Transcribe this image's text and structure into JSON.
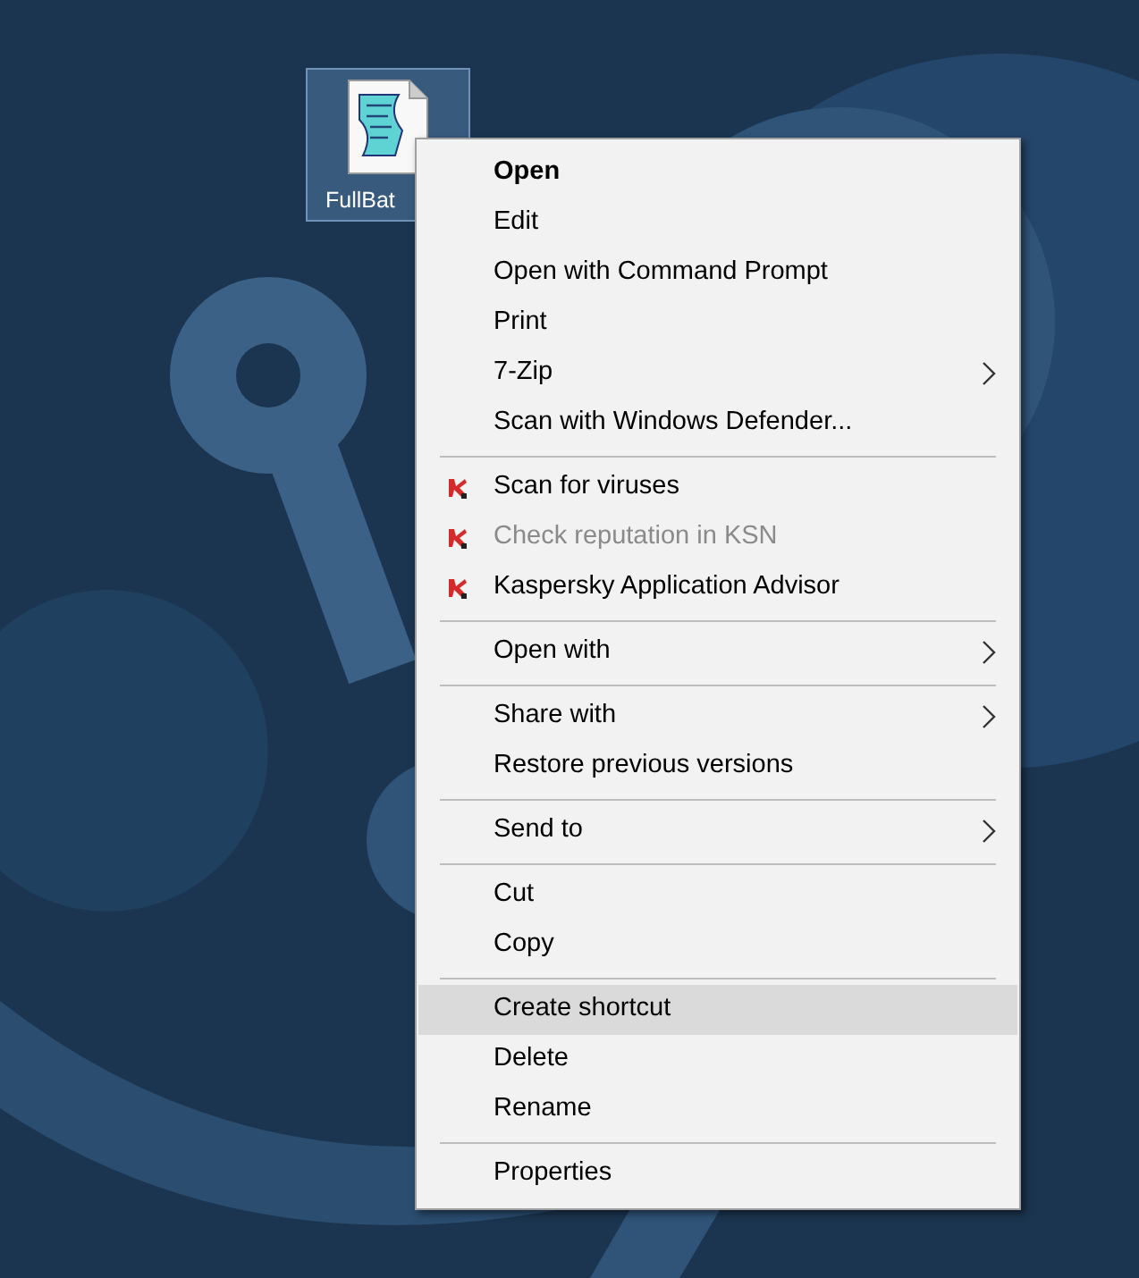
{
  "desktop": {
    "icons": [
      {
        "label": "FullBat",
        "selected": true
      }
    ]
  },
  "context_menu": {
    "sections": [
      {
        "items": [
          {
            "label": "Open",
            "kind": "plain",
            "default": true,
            "disabled": false,
            "selected": false
          },
          {
            "label": "Edit",
            "kind": "plain",
            "default": false,
            "disabled": false,
            "selected": false
          },
          {
            "label": "Open with Command Prompt",
            "kind": "plain",
            "default": false,
            "disabled": false,
            "selected": false
          },
          {
            "label": "Print",
            "kind": "plain",
            "default": false,
            "disabled": false,
            "selected": false
          },
          {
            "label": "7-Zip",
            "kind": "submenu",
            "default": false,
            "disabled": false,
            "selected": false
          },
          {
            "label": "Scan with Windows Defender...",
            "kind": "plain",
            "default": false,
            "disabled": false,
            "selected": false
          }
        ]
      },
      {
        "items": [
          {
            "label": "Scan for viruses",
            "kind": "kaspersky",
            "default": false,
            "disabled": false,
            "selected": false
          },
          {
            "label": "Check reputation in KSN",
            "kind": "kaspersky",
            "default": false,
            "disabled": true,
            "selected": false
          },
          {
            "label": "Kaspersky Application Advisor",
            "kind": "kaspersky",
            "default": false,
            "disabled": false,
            "selected": false
          }
        ]
      },
      {
        "items": [
          {
            "label": "Open with",
            "kind": "submenu",
            "default": false,
            "disabled": false,
            "selected": false
          }
        ]
      },
      {
        "items": [
          {
            "label": "Share with",
            "kind": "submenu",
            "default": false,
            "disabled": false,
            "selected": false
          },
          {
            "label": "Restore previous versions",
            "kind": "plain",
            "default": false,
            "disabled": false,
            "selected": false
          }
        ]
      },
      {
        "items": [
          {
            "label": "Send to",
            "kind": "submenu",
            "default": false,
            "disabled": false,
            "selected": false
          }
        ]
      },
      {
        "items": [
          {
            "label": "Cut",
            "kind": "plain",
            "default": false,
            "disabled": false,
            "selected": false
          },
          {
            "label": "Copy",
            "kind": "plain",
            "default": false,
            "disabled": false,
            "selected": false
          }
        ]
      },
      {
        "items": [
          {
            "label": "Create shortcut",
            "kind": "plain",
            "default": false,
            "disabled": false,
            "selected": true
          },
          {
            "label": "Delete",
            "kind": "plain",
            "default": false,
            "disabled": false,
            "selected": false
          },
          {
            "label": "Rename",
            "kind": "plain",
            "default": false,
            "disabled": false,
            "selected": false
          }
        ]
      },
      {
        "items": [
          {
            "label": "Properties",
            "kind": "plain",
            "default": false,
            "disabled": false,
            "selected": false
          }
        ]
      }
    ]
  }
}
